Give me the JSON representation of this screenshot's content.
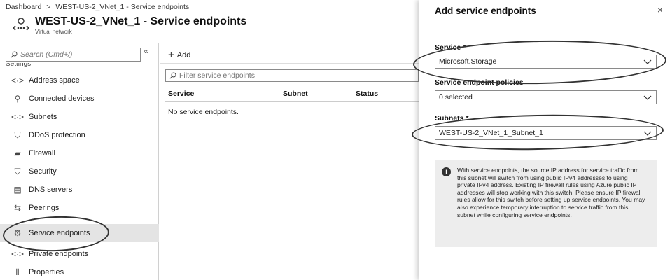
{
  "breadcrumb": {
    "root": "Dashboard",
    "separator": ">",
    "current": "WEST-US-2_VNet_1 - Service endpoints"
  },
  "header": {
    "title": "WEST-US-2_VNet_1 - Service endpoints",
    "subtitle": "Virtual network"
  },
  "sidebar": {
    "search_placeholder": "Search (Cmd+/)",
    "collapse_glyph": "«",
    "section_label": "Settings",
    "items": [
      {
        "label": "Address space",
        "icon": "address-space-icon",
        "glyph": "<·>"
      },
      {
        "label": "Connected devices",
        "icon": "plug-icon",
        "glyph": "⚲"
      },
      {
        "label": "Subnets",
        "icon": "subnets-icon",
        "glyph": "<·>"
      },
      {
        "label": "DDoS protection",
        "icon": "shield-icon",
        "glyph": "⛉"
      },
      {
        "label": "Firewall",
        "icon": "firewall-icon",
        "glyph": "▰"
      },
      {
        "label": "Security",
        "icon": "security-shield-icon",
        "glyph": "⛉"
      },
      {
        "label": "DNS servers",
        "icon": "dns-server-icon",
        "glyph": "▤"
      },
      {
        "label": "Peerings",
        "icon": "peerings-icon",
        "glyph": "⇆"
      },
      {
        "label": "Service endpoints",
        "icon": "service-endpoints-icon",
        "glyph": "⚙"
      },
      {
        "label": "Private endpoints",
        "icon": "private-endpoints-icon",
        "glyph": "<·>"
      },
      {
        "label": "Properties",
        "icon": "properties-icon",
        "glyph": "⦀"
      }
    ],
    "active_item": "Service endpoints"
  },
  "main": {
    "add_label": "Add",
    "filter_placeholder": "Filter service endpoints",
    "columns": [
      "Service",
      "Subnet",
      "Status"
    ],
    "empty_message": "No service endpoints."
  },
  "panel": {
    "title": "Add service endpoints",
    "close_glyph": "×",
    "service_label": "Service *",
    "service_value": "Microsoft.Storage",
    "policies_label": "Service endpoint policies",
    "policies_value": "0 selected",
    "subnets_label": "Subnets *",
    "subnets_value": "WEST-US-2_VNet_1_Subnet_1",
    "info_text": "With service endpoints, the source IP address for service traffic from this subnet will switch from using public IPv4 addresses to using private IPv4 address. Existing IP firewall rules using Azure public IP addresses will stop working with this switch. Please ensure IP firewall rules allow for this switch before setting up service endpoints. You may also experience temporary interruption to service traffic from this subnet while configuring service endpoints."
  },
  "colors": {
    "active_item_bg": "#e4e4e4",
    "info_box_bg": "#ededed",
    "annotation_oval": "#333333"
  }
}
